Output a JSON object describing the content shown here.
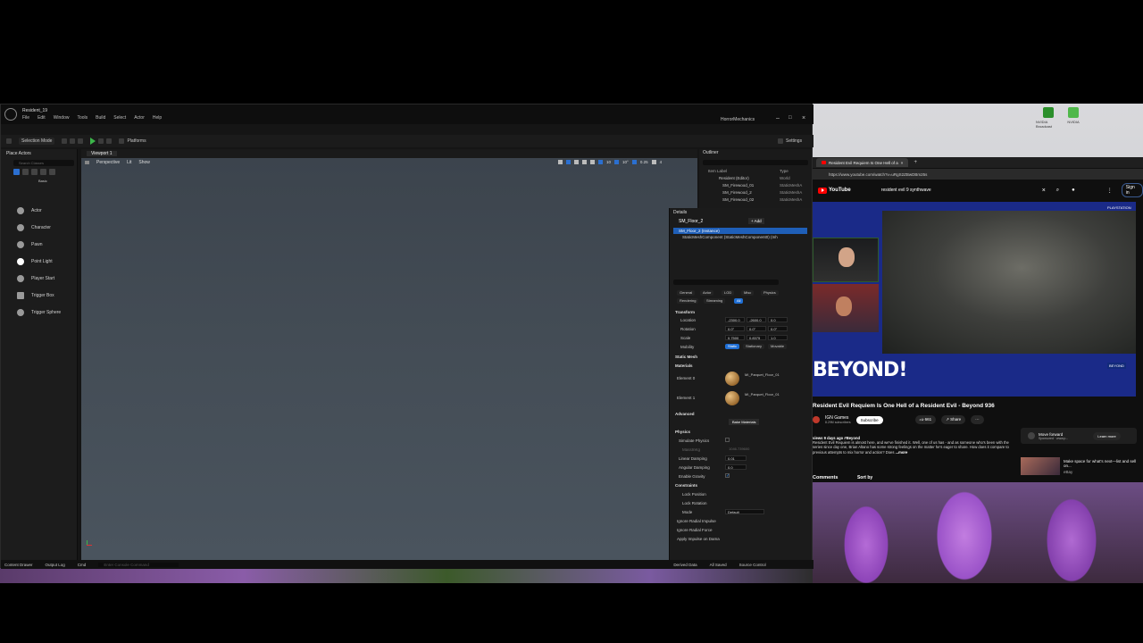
{
  "desktop": {
    "icon1_label": "NVIDIA Broadcast",
    "icon2_label": "NVIDIA"
  },
  "ue": {
    "tab_title": "Resident_19",
    "window_title": "HorrorMechanics",
    "menu": [
      "File",
      "Edit",
      "Window",
      "Tools",
      "Build",
      "Select",
      "Actor",
      "Help"
    ],
    "mode": "Selection Mode",
    "platforms": "Platforms",
    "settings": "Settings",
    "place_actors_tab": "Place Actors",
    "search_placeholder": "Search Classes",
    "basic_label": "Basic",
    "actors": [
      "Actor",
      "Character",
      "Pawn",
      "Point Light",
      "Player Start",
      "Trigger Box",
      "Trigger Sphere"
    ],
    "viewport_tab": "Viewport 1",
    "perspective": "Perspective",
    "lit": "Lit",
    "show": "Show",
    "snap_grid": "10",
    "snap_angle": "10°",
    "snap_scale": "0.25",
    "cam_speed": "4",
    "outliner": {
      "tab": "Outliner",
      "col_label": "Item Label",
      "col_type": "Type",
      "rows": [
        {
          "label": "Resident (Editor)",
          "type": "World"
        },
        {
          "label": "SM_Firewood_01",
          "type": "StaticMeshA"
        },
        {
          "label": "SM_Firewood_2",
          "type": "StaticMeshA"
        },
        {
          "label": "SM_Firewood_02",
          "type": "StaticMeshA"
        }
      ]
    },
    "details": {
      "tab": "Details",
      "object": "SM_Floor_2",
      "add": "+ Add",
      "instance": "SM_Floor_2 (Instance)",
      "component": "StaticMeshComponent (StaticMeshComponent0) (Inh",
      "filters": [
        "General",
        "Actor",
        "LOD",
        "Misc",
        "Physics",
        "Rendering",
        "Streaming",
        "All"
      ],
      "transform": "Transform",
      "location": "Location",
      "rotation": "Rotation",
      "scale": "Scale",
      "loc_vals": [
        "-2300.0",
        "-2600.0",
        "0.0"
      ],
      "rot_vals": [
        "0.0°",
        "0.0°",
        "0.0°"
      ],
      "scale_vals": [
        "0.7500",
        "0.8375",
        "1.0"
      ],
      "mobility": "Mobility",
      "mobility_opts": [
        "Static",
        "Stationary",
        "Movable"
      ],
      "static_mesh": "Static Mesh",
      "materials": "Materials",
      "element0": "Element 0",
      "element1": "Element 1",
      "mat0": "MI_Parquet_Floor_01",
      "mat1": "MI_Parquet_Floor_01",
      "advanced": "Advanced",
      "bake": "Bake Materials",
      "physics": "Physics",
      "simulate": "Simulate Physics",
      "mass": "MassInKg",
      "mass_val": "1046.739600",
      "lin_damp": "Linear Damping",
      "lin_val": "0.01",
      "ang_damp": "Angular Damping",
      "ang_val": "0.0",
      "gravity": "Enable Gravity",
      "constraints": "Constraints",
      "lock_pos": "Lock Position",
      "lock_rot": "Lock Rotation",
      "mode": "Mode",
      "mode_val": "Default",
      "ignore_radial": "Ignore Radial Impulse",
      "ignore_force": "Ignore Radial Force",
      "apply_impulse": "Apply Impulse on Dama"
    },
    "status": {
      "content_drawer": "Content Drawer",
      "output_log": "Output Log",
      "cmd": "Cmd",
      "cmd_placeholder": "Enter Console Command",
      "derived": "Derived Data",
      "all_saved": "All Saved",
      "source_control": "Source Control"
    }
  },
  "browser": {
    "tab_title": "Resident Evil Requiem Is One Hell of a",
    "url": "https://www.youtube.com/watch?v=uRgS2ZBwDBm25s",
    "logo": "YouTube",
    "search": "resident evil 9 synthwave",
    "sign_in": "Sign in",
    "beyond": "BEYOND!",
    "badge_brand": "PLAYSTATION",
    "badge_beyond": "BEYOND",
    "video_title": "Resident Evil Requiem Is One Hell of a Resident Evil - Beyond 936",
    "channel": "IGN Games",
    "subscribers": "8.29M subscribers",
    "subscribe": "Subscribe",
    "likes": "661",
    "share": "Share",
    "desc_meta": "views 9 days ago  #Beyond",
    "desc_body": "Resident Evil Requiem is almost here, and we've finished it. Well, one of us has - and as someone who's been with the series since day one, Brian Altano has some strong feelings on the matter he's eager to share. How does it compare to previous attempts to mix horror and action? Does",
    "more": "...more",
    "comments": "Comments",
    "sort": "Sort by",
    "ad_title": "Move forward",
    "ad_sub": "Sponsored · www.p...",
    "learn_more": "Learn more",
    "rec_title": "Make space for what's next—list and sell on...",
    "rec_sub": "eBay"
  }
}
